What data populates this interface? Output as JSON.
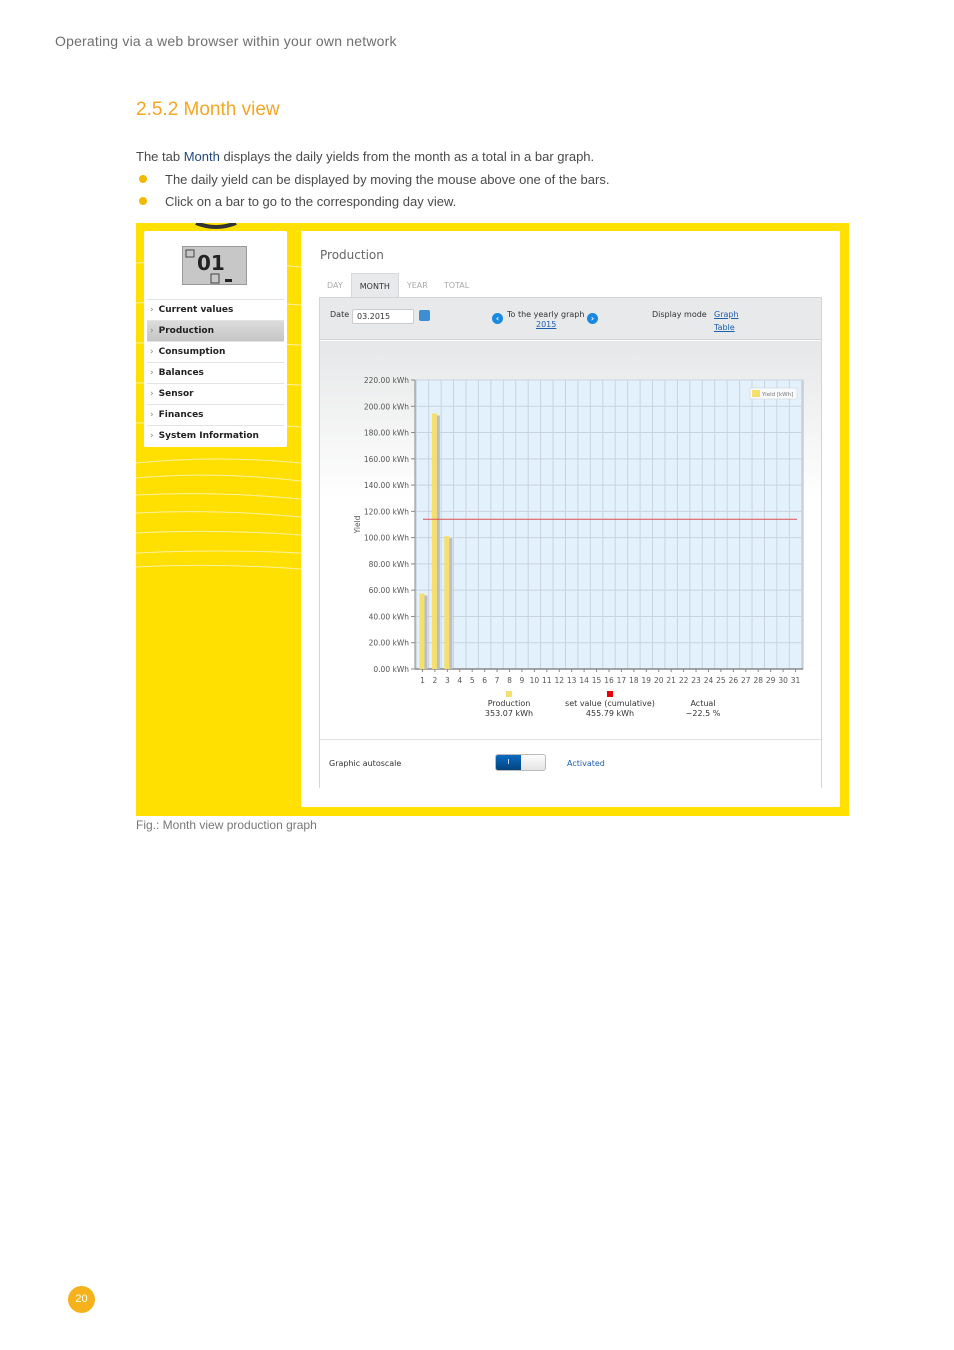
{
  "page": {
    "running_header": "Operating via a web browser within your own network",
    "section_title": "2.5.2  Month view",
    "intro_prefix": "The tab ",
    "intro_highlight": "Month",
    "intro_suffix": " displays the daily yields from the month as a total in a bar graph.",
    "bullets": [
      "The daily yield can be displayed by moving the mouse above one of the bars.",
      "Click on a bar to go to the corresponding day view."
    ],
    "caption": "Fig.: Month view production graph",
    "page_number": "20"
  },
  "screenshot": {
    "lcd_display": "01",
    "sidebar": {
      "items": [
        {
          "label": "Current values",
          "active": false
        },
        {
          "label": "Production",
          "active": true
        },
        {
          "label": "Consumption",
          "active": false
        },
        {
          "label": "Balances",
          "active": false
        },
        {
          "label": "Sensor",
          "active": false
        },
        {
          "label": "Finances",
          "active": false
        },
        {
          "label": "System Information",
          "active": false
        }
      ],
      "chevron": "›"
    },
    "panel_title": "Production",
    "tabs": [
      {
        "label": "DAY",
        "active": false
      },
      {
        "label": "MONTH",
        "active": true
      },
      {
        "label": "YEAR",
        "active": false
      },
      {
        "label": "TOTAL",
        "active": false
      }
    ],
    "toolbar": {
      "date_label": "Date",
      "date_value": "03.2015",
      "calendar_icon": "calendar-icon",
      "yearly_label": "To the yearly graph",
      "yearly_link": "2015",
      "prev_icon": "‹",
      "next_icon": "›",
      "display_mode_label": "Display mode",
      "mode_graph": "Graph",
      "mode_table": "Table"
    },
    "summary": [
      {
        "label": "Production",
        "value": "353.07 kWh",
        "color": "#f5e06e"
      },
      {
        "label": "set value (cumulative)",
        "value": "455.79 kWh",
        "color": "#e8000b"
      },
      {
        "label": "Actual",
        "value": "−22.5 %",
        "color": null
      }
    ],
    "autoscale": {
      "label": "Graphic autoscale",
      "toggle_on_text": "I",
      "status": "Activated",
      "enabled": true
    }
  },
  "chart_data": {
    "type": "bar",
    "title": "",
    "xlabel": "",
    "ylabel": "Yield",
    "legend": [
      {
        "name": "Yield [kWh]",
        "color": "#f5e06e",
        "placement": "top-right"
      }
    ],
    "categories": [
      "1",
      "2",
      "3",
      "4",
      "5",
      "6",
      "7",
      "8",
      "9",
      "10",
      "11",
      "12",
      "13",
      "14",
      "15",
      "16",
      "17",
      "18",
      "19",
      "20",
      "21",
      "22",
      "23",
      "24",
      "25",
      "26",
      "27",
      "28",
      "29",
      "30",
      "31"
    ],
    "values": [
      57.5,
      194.5,
      101.1,
      0,
      0,
      0,
      0,
      0,
      0,
      0,
      0,
      0,
      0,
      0,
      0,
      0,
      0,
      0,
      0,
      0,
      0,
      0,
      0,
      0,
      0,
      0,
      0,
      0,
      0,
      0,
      0
    ],
    "ylim": [
      0,
      220
    ],
    "yticks": [
      0,
      20,
      40,
      60,
      80,
      100,
      120,
      140,
      160,
      180,
      200,
      220
    ],
    "ytick_labels": [
      "0.00 kWh",
      "20.00 kWh",
      "40.00 kWh",
      "60.00 kWh",
      "80.00 kWh",
      "100.00 kWh",
      "120.00 kWh",
      "140.00 kWh",
      "160.00 kWh",
      "180.00 kWh",
      "200.00 kWh",
      "220.00 kWh"
    ],
    "target_line": {
      "name": "set value",
      "value": 114,
      "color": "#e05050"
    },
    "grid": true,
    "bar_color": "#f5e06e",
    "plot_bg": "#e3f1fd"
  }
}
